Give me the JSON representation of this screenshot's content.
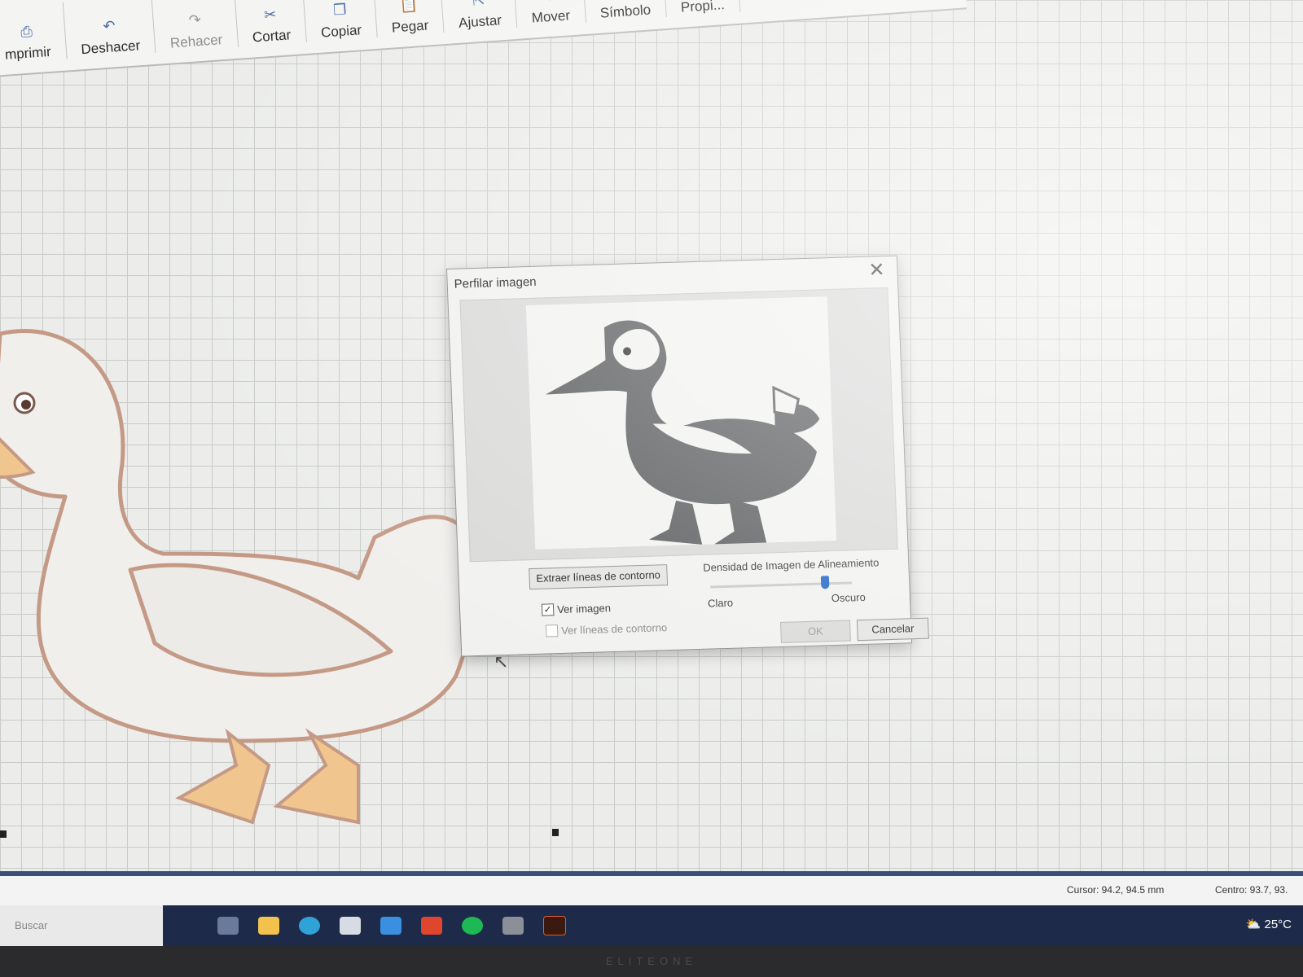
{
  "ribbon": {
    "items": [
      {
        "label": "mprimir",
        "icon": "printer-icon",
        "enabled": true
      },
      {
        "label": "Deshacer",
        "icon": "undo-icon",
        "enabled": true
      },
      {
        "label": "Rehacer",
        "icon": "redo-icon",
        "enabled": false
      },
      {
        "label": "Cortar",
        "icon": "scissors-icon",
        "enabled": true
      },
      {
        "label": "Copiar",
        "icon": "copy-icon",
        "enabled": true
      },
      {
        "label": "Pegar",
        "icon": "paste-icon",
        "enabled": true
      },
      {
        "label": "Ajustar",
        "icon": "align-icon",
        "enabled": true
      },
      {
        "label": "Mover",
        "icon": "move-icon",
        "enabled": true
      },
      {
        "label": "Símbolo",
        "icon": "symbol-icon",
        "enabled": true
      },
      {
        "label": "Propi...",
        "icon": "properties-icon",
        "enabled": true
      }
    ]
  },
  "dialog": {
    "title": "Perfilar imagen",
    "extract_button": "Extraer líneas de contorno",
    "density_label": "Densidad de Imagen de Alineamiento",
    "slider_min_label": "Claro",
    "slider_max_label": "Oscuro",
    "slider_value": 0.8,
    "show_image": {
      "label": "Ver imagen",
      "checked": true
    },
    "show_contours": {
      "label": "Ver líneas de contorno",
      "checked": false,
      "enabled": false
    },
    "ok_button": "OK",
    "cancel_button": "Cancelar"
  },
  "status": {
    "cursor": "Cursor: 94.2, 94.5 mm",
    "center": "Centro: 93.7, 93."
  },
  "taskbar": {
    "search_placeholder": "Buscar",
    "weather": "25°C"
  },
  "monitor_brand": "ELITEONE",
  "colors": {
    "accent": "#1f63c9",
    "taskbar": "#1e2a4a",
    "duck_outline": "#c49a86",
    "duck_feet": "#f0c58e"
  }
}
